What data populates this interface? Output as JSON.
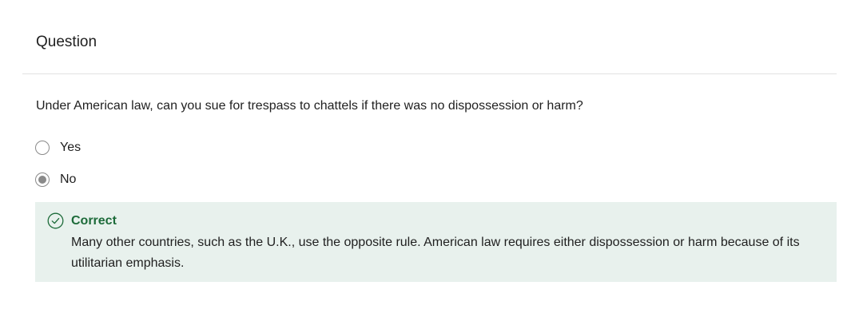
{
  "header": {
    "title": "Question"
  },
  "question": {
    "text": "Under American law, can you sue for trespass to chattels if there was no dispossession or harm?"
  },
  "options": [
    {
      "label": "Yes",
      "selected": false
    },
    {
      "label": "No",
      "selected": true
    }
  ],
  "feedback": {
    "status": "Correct",
    "message": "Many other countries, such as the U.K., use the opposite rule. American law requires either dispossession or harm because of its utilitarian emphasis.",
    "icon": "check-circle-icon",
    "colors": {
      "background": "#e8f1ed",
      "accent": "#1d6b3a"
    }
  }
}
